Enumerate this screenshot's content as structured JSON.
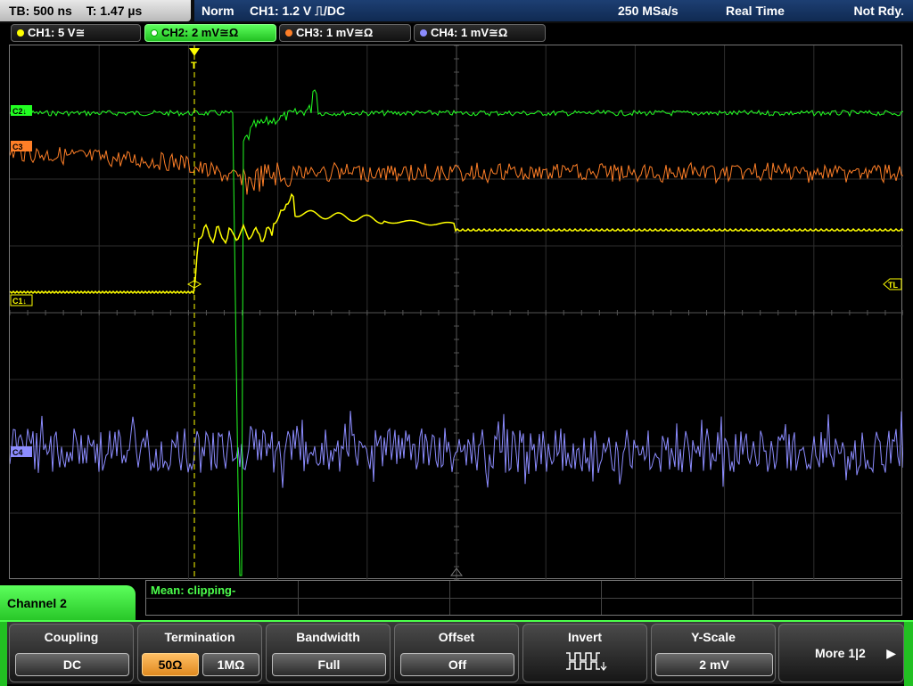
{
  "top": {
    "timebase": "TB: 500 ns",
    "trigger_time": "T: 1.47 µs",
    "trigger_mode": "Norm",
    "trigger_info": "CH1: 1.2 V ⎍/DC",
    "sample_rate": "250 MSa/s",
    "acq_mode": "Real Time",
    "status": "Not Rdy."
  },
  "channels": [
    {
      "label": "CH1: 5 V≅",
      "color": "#ffff00"
    },
    {
      "label": "CH2: 2 mV≅Ω",
      "color": "#22ff22"
    },
    {
      "label": "CH3: 1 mV≅Ω",
      "color": "#ff7f27"
    },
    {
      "label": "CH4: 1 mV≅Ω",
      "color": "#8c8cff"
    }
  ],
  "markers": {
    "c2": "C2↓",
    "c1": "C1↓",
    "c3": "C3",
    "c4": "C4",
    "tl": "TL",
    "trigger_t": "T"
  },
  "measurement": {
    "text": "Mean: clipping-"
  },
  "menu": {
    "title": "Channel 2",
    "coupling": {
      "title": "Coupling",
      "value": "DC"
    },
    "termination": {
      "title": "Termination",
      "opt1": "50Ω",
      "opt2": "1MΩ"
    },
    "bandwidth": {
      "title": "Bandwidth",
      "value": "Full"
    },
    "offset": {
      "title": "Offset",
      "value": "Off"
    },
    "invert": {
      "title": "Invert"
    },
    "yscale": {
      "title": "Y-Scale",
      "value": "2 mV"
    },
    "more": {
      "label": "More 1|2"
    }
  },
  "colors": {
    "ch1": "#ffff00",
    "ch2": "#22ff22",
    "ch3": "#ff7f27",
    "ch4": "#8c8cff",
    "grid": "#3a3a3a"
  }
}
